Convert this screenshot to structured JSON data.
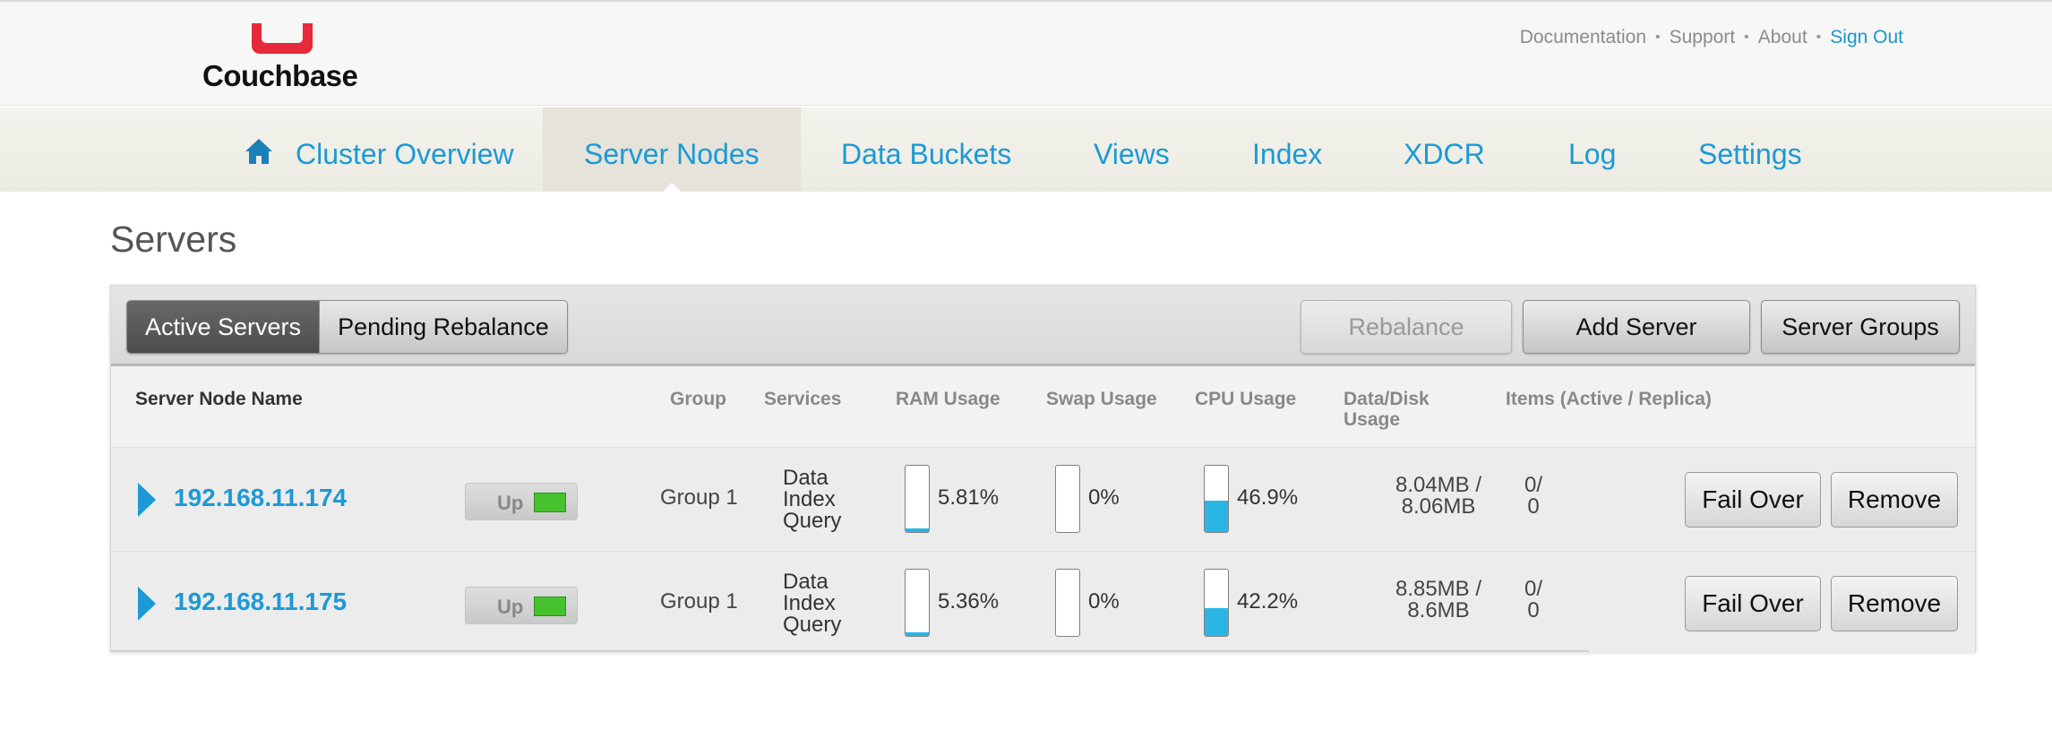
{
  "brand": {
    "logo_text": "Couchbase",
    "accent": "#e8293a"
  },
  "top_links": {
    "documentation": "Documentation",
    "support": "Support",
    "about": "About",
    "sign_out": "Sign Out",
    "separator": "•"
  },
  "nav": {
    "home_icon": "home-icon",
    "items": [
      "Cluster Overview",
      "Server Nodes",
      "Data Buckets",
      "Views",
      "Index",
      "XDCR",
      "Log",
      "Settings"
    ],
    "active": "Server Nodes"
  },
  "page": {
    "title": "Servers"
  },
  "toolbar": {
    "tabs": [
      "Active Servers",
      "Pending Rebalance"
    ],
    "active_tab": "Active Servers",
    "rebalance": "Rebalance",
    "add_server": "Add Server",
    "server_groups": "Server Groups"
  },
  "table": {
    "headers": {
      "name": "Server Node Name",
      "group": "Group",
      "services": "Services",
      "ram": "RAM Usage",
      "swap": "Swap Usage",
      "cpu": "CPU Usage",
      "disk_line1": "Data/Disk",
      "disk_line2": "Usage",
      "items": "Items (Active / Replica)"
    },
    "rows": [
      {
        "ip": "192.168.11.174",
        "status": "Up",
        "group": "Group 1",
        "services": [
          "Data",
          "Index",
          "Query"
        ],
        "ram": "5.81%",
        "ram_fraction": 0.0581,
        "swap": "0%",
        "swap_fraction": 0,
        "cpu": "46.9%",
        "cpu_fraction": 0.469,
        "disk_line1": "8.04MB /",
        "disk_line2": "8.06MB",
        "items_line1": "0/",
        "items_line2": "0",
        "fail_over": "Fail Over",
        "remove": "Remove"
      },
      {
        "ip": "192.168.11.175",
        "status": "Up",
        "group": "Group 1",
        "services": [
          "Data",
          "Index",
          "Query"
        ],
        "ram": "5.36%",
        "ram_fraction": 0.0536,
        "swap": "0%",
        "swap_fraction": 0,
        "cpu": "42.2%",
        "cpu_fraction": 0.422,
        "disk_line1": "8.85MB /",
        "disk_line2": "8.6MB",
        "items_line1": "0/",
        "items_line2": "0",
        "fail_over": "Fail Over",
        "remove": "Remove"
      }
    ]
  },
  "colors": {
    "link": "#1b9ad6",
    "status_ok": "#46c22e",
    "gauge_fill": "#29b6e6"
  }
}
